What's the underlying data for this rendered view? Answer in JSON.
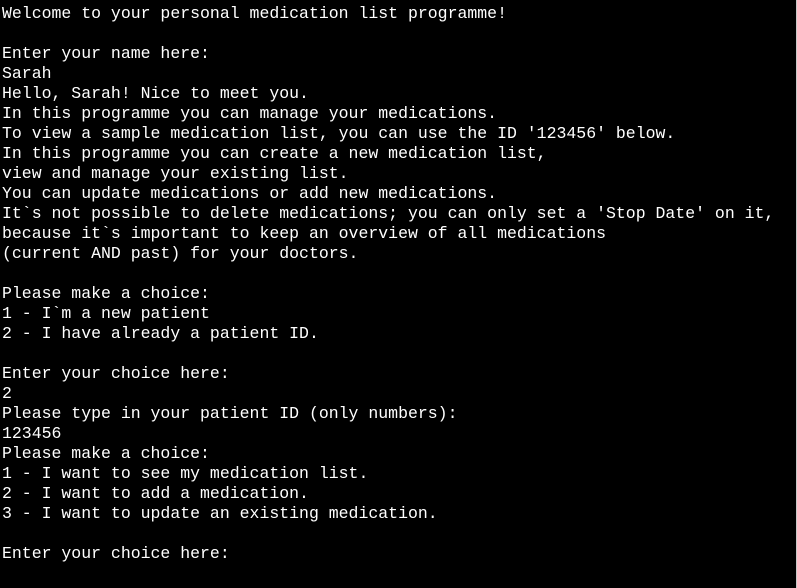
{
  "terminal": {
    "colors": {
      "background": "#000000",
      "foreground": "#ffffff"
    },
    "lines": [
      "Welcome to your personal medication list programme!",
      "",
      "Enter your name here:",
      "Sarah",
      "Hello, Sarah! Nice to meet you.",
      "In this programme you can manage your medications.",
      "To view a sample medication list, you can use the ID '123456' below.",
      "In this programme you can create a new medication list,",
      "view and manage your existing list.",
      "You can update medications or add new medications.",
      "It`s not possible to delete medications; you can only set a 'Stop Date' on it,",
      "because it`s important to keep an overview of all medications",
      "(current AND past) for your doctors.",
      "",
      "Please make a choice:",
      "1 - I`m a new patient",
      "2 - I have already a patient ID.",
      "",
      "Enter your choice here:",
      "2",
      "Please type in your patient ID (only numbers):",
      "123456",
      "Please make a choice:",
      "1 - I want to see my medication list.",
      "2 - I want to add a medication.",
      "3 - I want to update an existing medication.",
      "",
      "Enter your choice here:"
    ]
  }
}
